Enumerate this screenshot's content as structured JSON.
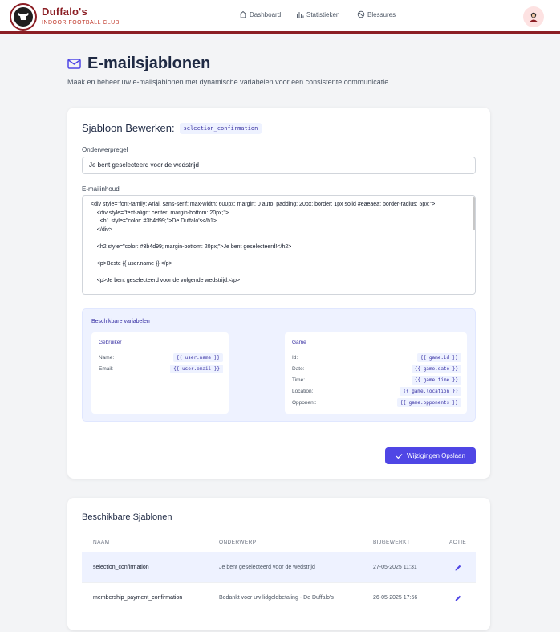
{
  "brand": {
    "name": "Duffalo's",
    "subtitle": "INDOOR FOOTBALL CLUB"
  },
  "nav": {
    "dashboard": "Dashboard",
    "statistics": "Statistieken",
    "injuries": "Blessures"
  },
  "page": {
    "title": "E-mailsjablonen",
    "subtitle": "Maak en beheer uw e-mailsjablonen met dynamische variabelen voor een consistente communicatie."
  },
  "editor": {
    "title": "Sjabloon Bewerken:",
    "template_key": "selection_confirmation",
    "subject_label": "Onderwerpregel",
    "subject_value": "Je bent geselecteerd voor de wedstrijd",
    "body_label": "E-mailinhoud",
    "body_value": "<div style=\"font-family: Arial, sans-serif; max-width: 600px; margin: 0 auto; padding: 20px; border: 1px solid #eaeaea; border-radius: 5px;\">\n    <div style=\"text-align: center; margin-bottom: 20px;\">\n      <h1 style=\"color: #3b4d99;\">De Duffalo's</h1>\n    </div>\n\n    <h2 style=\"color: #3b4d99; margin-bottom: 20px;\">Je bent geselecteerd!</h2>\n\n    <p>Beste {{ user.name }},</p>\n\n    <p>Je bent geselecteerd voor de volgende wedstrijd:</p>",
    "variables_title": "Beschikbare variabelen",
    "groups": {
      "user": {
        "title": "Gebruiker",
        "items": [
          {
            "key": "Name:",
            "value": "{{ user.name }}"
          },
          {
            "key": "Email:",
            "value": "{{ user.email }}"
          }
        ]
      },
      "game": {
        "title": "Game",
        "items": [
          {
            "key": "Id:",
            "value": "{{ game.id }}"
          },
          {
            "key": "Date:",
            "value": "{{ game.date }}"
          },
          {
            "key": "Time:",
            "value": "{{ game.time }}"
          },
          {
            "key": "Location:",
            "value": "{{ game.location }}"
          },
          {
            "key": "Opponent:",
            "value": "{{ game.opponents }}"
          }
        ]
      }
    },
    "save_label": "Wijzigingen Opslaan"
  },
  "templates": {
    "title": "Beschikbare Sjablonen",
    "columns": [
      "NAAM",
      "ONDERWERP",
      "BIJGEWERKT",
      "ACTIE"
    ],
    "rows": [
      {
        "name": "selection_confirmation",
        "subject": "Je bent geselecteerd voor de wedstrijd",
        "updated": "27-05-2025 11:31"
      },
      {
        "name": "membership_payment_confirmation",
        "subject": "Bedankt voor uw lidgeldbetaling - De Duffalo's",
        "updated": "26-05-2025 17:56"
      }
    ]
  },
  "colors": {
    "brand": "#8b1e24",
    "accent": "#4f46e5",
    "highlight": "#eef2ff"
  },
  "icons": [
    "home-icon",
    "bar-chart-icon",
    "ban-icon",
    "mail-icon",
    "check-icon",
    "pencil-icon",
    "avatar-icon"
  ]
}
